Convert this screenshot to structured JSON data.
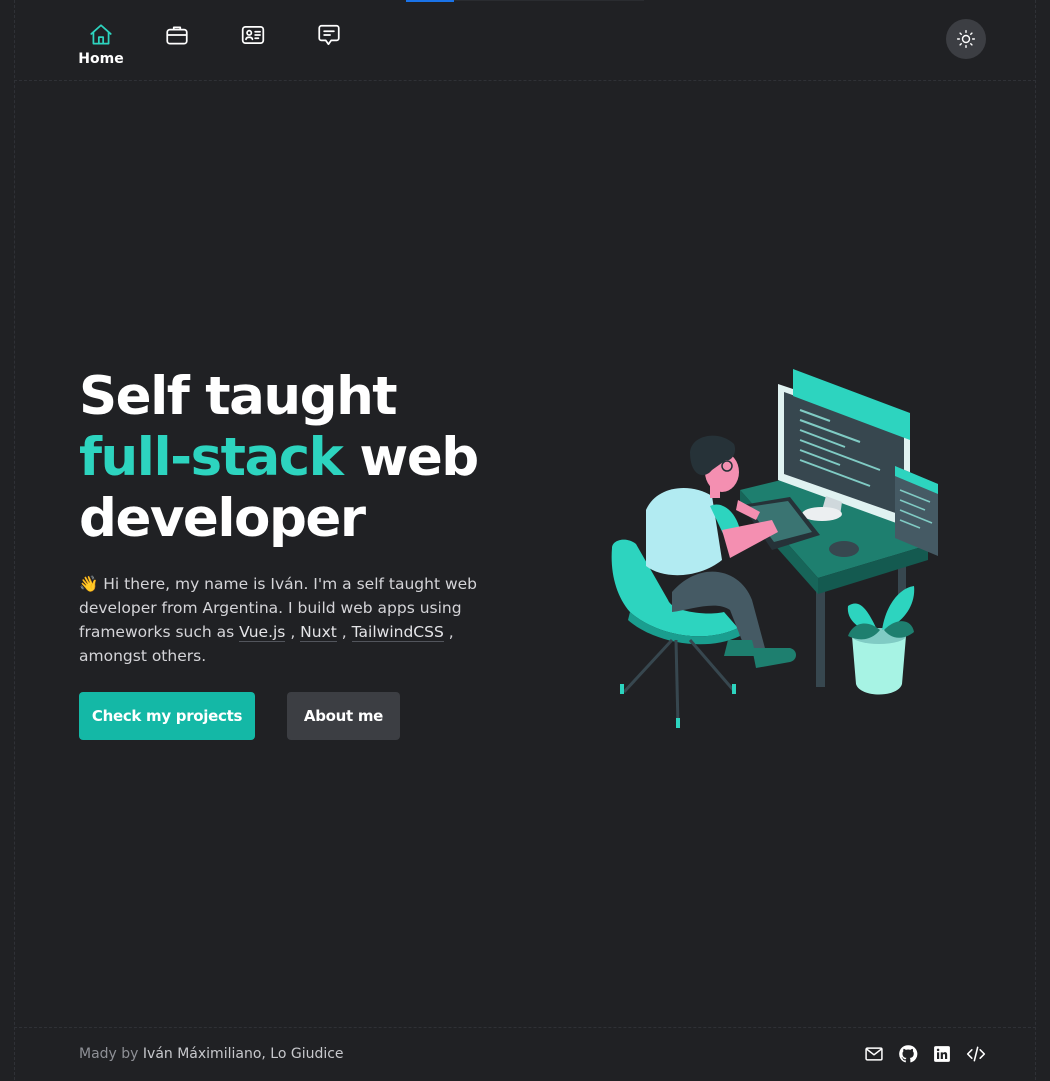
{
  "nav": {
    "items": [
      {
        "icon": "home-icon",
        "label": "Home",
        "active": true
      },
      {
        "icon": "briefcase-icon",
        "label": "",
        "active": false
      },
      {
        "icon": "id-card-icon",
        "label": "",
        "active": false
      },
      {
        "icon": "chat-icon",
        "label": "",
        "active": false
      }
    ],
    "theme_toggle_icon": "sun-icon"
  },
  "hero": {
    "title_line1": "Self taught",
    "title_accent": "full-stack",
    "title_rest": " web",
    "title_line3": "developer",
    "intro_emoji": "👋",
    "intro_text": " Hi there, my name is Iván. I'm a self taught web developer from Argentina. I build web apps using frameworks such as ",
    "tech": [
      "Vue.js",
      "Nuxt",
      "TailwindCSS"
    ],
    "intro_end": " , amongst others.",
    "sep": " , ",
    "primary_button": "Check my projects",
    "secondary_button": "About me"
  },
  "footer": {
    "prefix": "Mady by ",
    "author": "Iván Máximiliano, Lo Giudice",
    "social_icons": [
      "mail-icon",
      "github-icon",
      "linkedin-icon",
      "code-icon"
    ]
  },
  "colors": {
    "background": "#202124",
    "accent": "#2dd4bf",
    "primary_button": "#14b8a6",
    "secondary_button": "#3c3e43"
  }
}
